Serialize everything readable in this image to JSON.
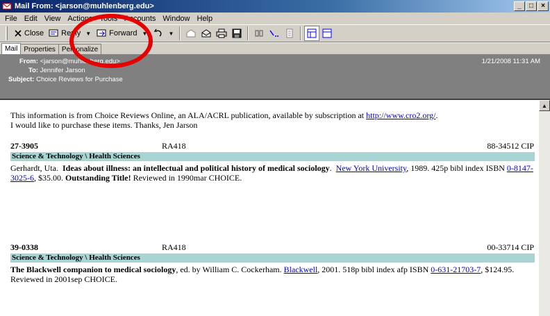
{
  "window": {
    "title": "Mail From: <jarson@muhlenberg.edu>"
  },
  "menu": [
    "File",
    "Edit",
    "View",
    "Actions",
    "Tools",
    "Accounts",
    "Window",
    "Help"
  ],
  "toolbar": {
    "close": "Close",
    "reply": "Reply",
    "forward": "Forward"
  },
  "tabs": [
    "Mail",
    "Properties",
    "Personalize"
  ],
  "header": {
    "from_label": "From:",
    "from_value": "<jarson@muhlenberg.edu>",
    "to_label": "To:",
    "to_value": "Jennifer Jarson",
    "subject_label": "Subject:",
    "subject_value": "Choice Reviews for Purchase",
    "date": "1/21/2008 11:31 AM"
  },
  "message": {
    "intro_1": "This information is from Choice Reviews Online, an ALA/ACRL publication, available by subscription at ",
    "intro_link": "http://www.cro2.org/",
    "intro_1_end": ".",
    "intro_2": "I would like to purchase these items. Thanks, Jen Jarson",
    "records": [
      {
        "number": "27-3905",
        "call": "RA418",
        "cip": "88-34512 CIP",
        "subject": "Science & Technology \\ Health Sciences",
        "author": "Gerhardt, Uta.",
        "title": "Ideas about illness: an intellectual and political history of medical sociology",
        "publisher": "New York University",
        "after_pub": ", 1989.  425p bibl index ISBN ",
        "isbn": "0-8147-3025-6",
        "price": ", $35.00.  ",
        "note": "Outstanding Title!",
        "reviewed": " Reviewed in 1990mar CHOICE."
      },
      {
        "number": "39-0338",
        "call": "RA418",
        "cip": "00-33714 CIP",
        "subject": "Science & Technology \\ Health Sciences",
        "title": "The Blackwell companion to medical sociology",
        "editor": ", ed. by William C. Cockerham.  ",
        "publisher": "Blackwell",
        "after_pub": ", 2001.  518p bibl index afp ISBN ",
        "isbn": "0-631-21703-7",
        "price": ", $124.95. Reviewed in 2001sep CHOICE."
      }
    ]
  },
  "colors": {
    "annotation": "#e60000",
    "subject_bar": "#a8d4d4",
    "header_bg": "#808080"
  }
}
